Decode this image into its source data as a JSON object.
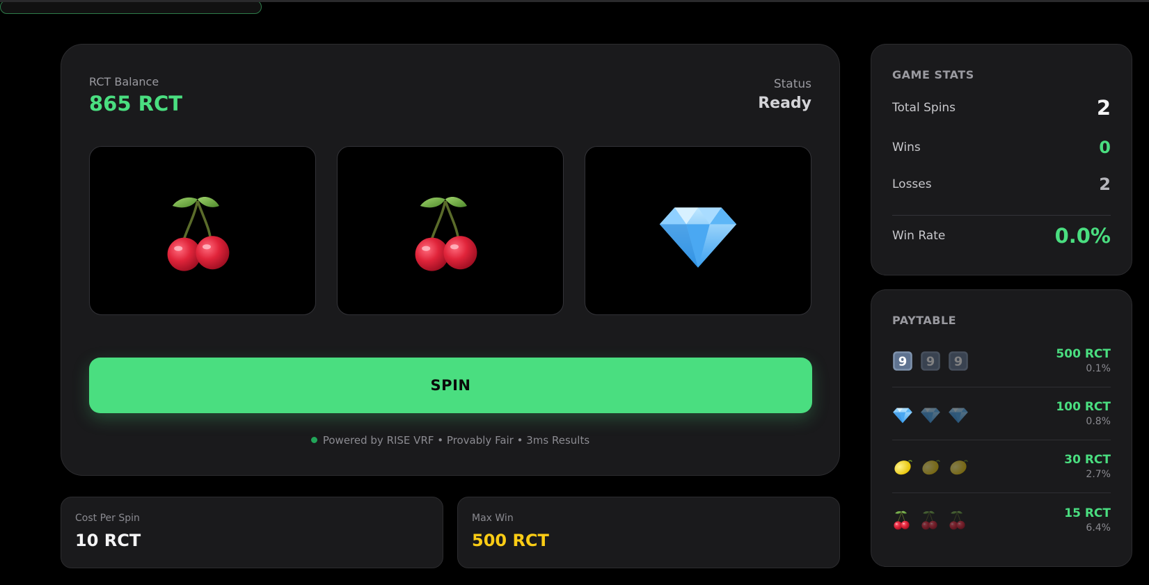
{
  "balance": {
    "label": "RCT Balance",
    "value": "865 RCT"
  },
  "status": {
    "label": "Status",
    "value": "Ready"
  },
  "reels": [
    {
      "symbol": "cherries-icon"
    },
    {
      "symbol": "cherries-icon"
    },
    {
      "symbol": "diamond-icon"
    }
  ],
  "spin_button": {
    "label": "SPIN"
  },
  "footer_note": "Powered by RISE VRF • Provably Fair • 3ms Results",
  "cost": {
    "label": "Cost Per Spin",
    "value": "10 RCT"
  },
  "max_win": {
    "label": "Max Win",
    "value": "500 RCT"
  },
  "stats": {
    "title": "GAME STATS",
    "total_spins": {
      "label": "Total Spins",
      "value": "2"
    },
    "wins": {
      "label": "Wins",
      "value": "0"
    },
    "losses": {
      "label": "Losses",
      "value": "2"
    },
    "win_rate": {
      "label": "Win Rate",
      "value": "0.0%"
    }
  },
  "paytable": {
    "title": "PAYTABLE",
    "rows": [
      {
        "symbol": "nine-icon",
        "payout": "500 RCT",
        "odds": "0.1%"
      },
      {
        "symbol": "diamond-icon",
        "payout": "100 RCT",
        "odds": "0.8%"
      },
      {
        "symbol": "lemon-icon",
        "payout": "30 RCT",
        "odds": "2.7%"
      },
      {
        "symbol": "cherries-icon",
        "payout": "15 RCT",
        "odds": "6.4%"
      }
    ]
  },
  "colors": {
    "accent": "#4ade80",
    "gold": "#facc15",
    "panel": "#1a1a1c",
    "background": "#000000"
  }
}
